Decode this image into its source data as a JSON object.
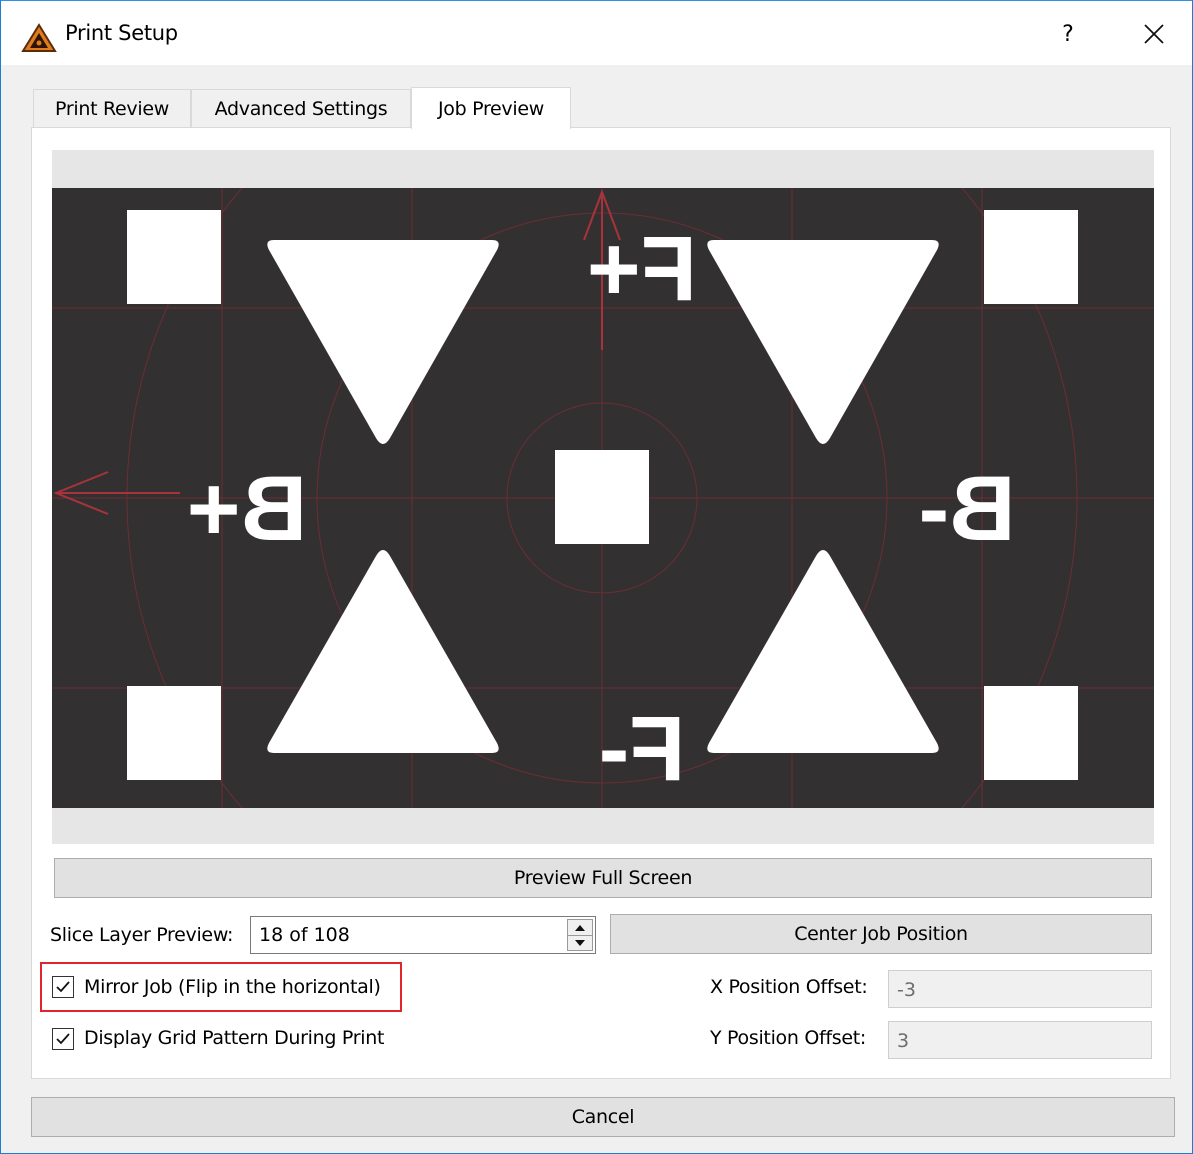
{
  "window": {
    "title": "Print Setup",
    "help": "?",
    "app_icon": "printer-triangle-icon",
    "close_icon": "close-icon"
  },
  "tabs": [
    {
      "label": "Print Review",
      "active": false
    },
    {
      "label": "Advanced Settings",
      "active": false
    },
    {
      "label": "Job Preview",
      "active": true
    }
  ],
  "preview": {
    "labels": [
      "F+",
      "F-",
      "B+",
      "B-"
    ],
    "background_color": "#333032",
    "grid_color": "#6b2e33",
    "shape_color": "#ffffff"
  },
  "buttons": {
    "preview_full_screen": "Preview Full Screen",
    "center_job_position": "Center Job Position",
    "cancel": "Cancel"
  },
  "slice_layer": {
    "label": "Slice Layer Preview:",
    "value": "18 of 108"
  },
  "checkboxes": {
    "mirror_job": {
      "label": "Mirror Job (Flip in the horizontal)",
      "checked": true
    },
    "display_grid": {
      "label": "Display Grid Pattern During Print",
      "checked": true
    }
  },
  "offsets": {
    "x_label": "X Position Offset:",
    "x_value": "-3",
    "y_label": "Y Position Offset:",
    "y_value": "3"
  },
  "accent": {
    "highlight_color": "#e0262b",
    "window_border": "#1a7fd4"
  }
}
